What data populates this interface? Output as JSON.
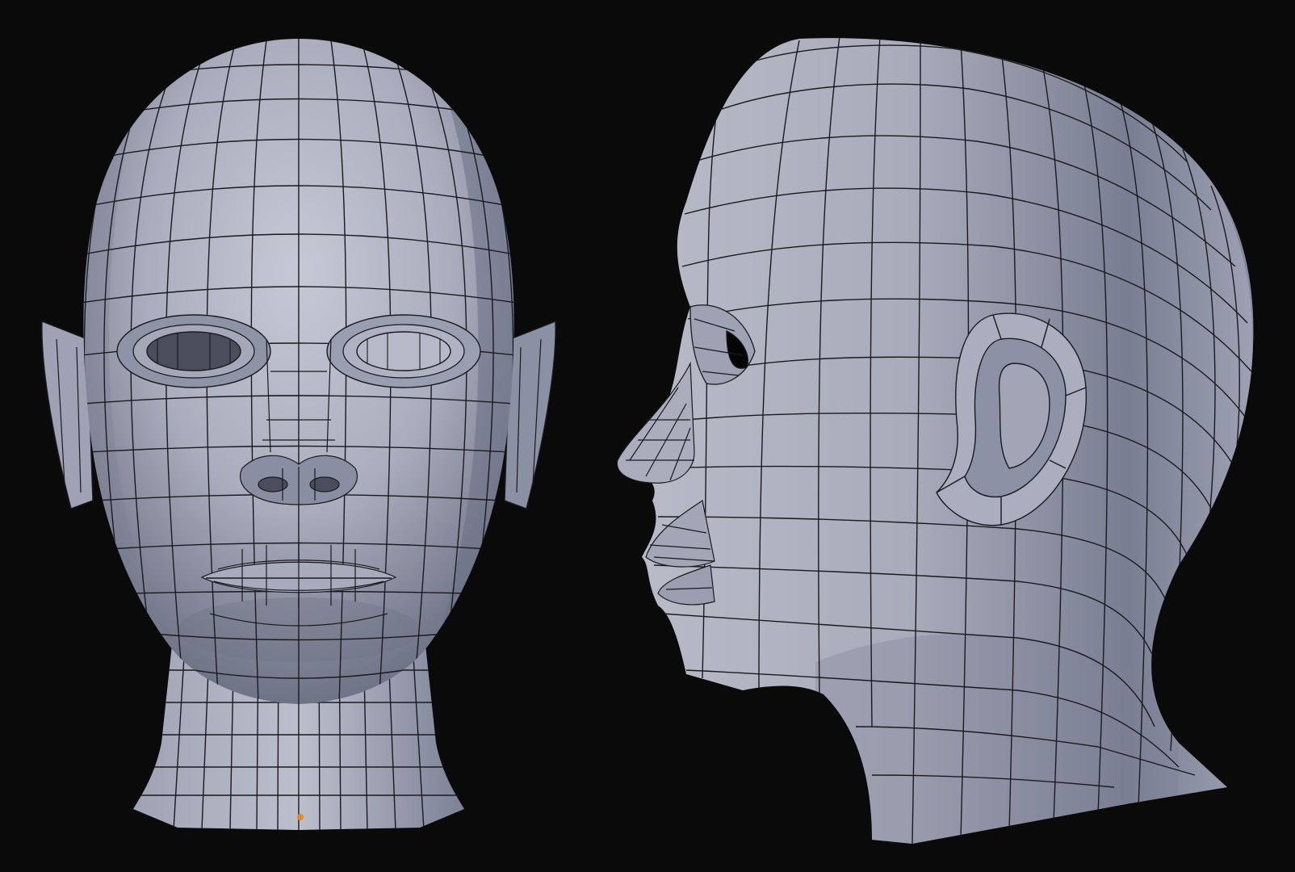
{
  "viewport": {
    "background": "#0a0a0a",
    "mesh_color_light": "#c3c6d2",
    "mesh_color_mid": "#9a9eb0",
    "mesh_color_dark": "#5f6274",
    "wire_color": "#1a1a1e",
    "origin_color": "#e08a2a"
  },
  "views": [
    {
      "key": "front",
      "object": "head-mesh"
    },
    {
      "key": "side",
      "object": "head-mesh"
    }
  ]
}
